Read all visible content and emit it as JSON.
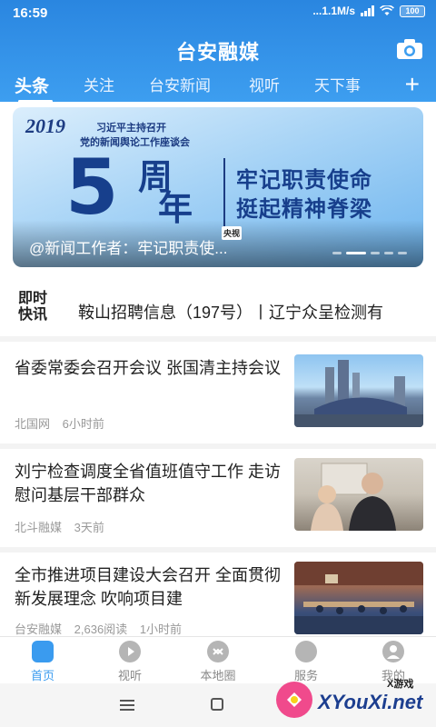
{
  "status_bar": {
    "time": "16:59",
    "speed": "...1.1M/s",
    "battery": "100"
  },
  "header": {
    "app_title": "台安融媒",
    "tabs": [
      {
        "label": "头条",
        "active": true
      },
      {
        "label": "关注"
      },
      {
        "label": "台安新闻"
      },
      {
        "label": "视听"
      },
      {
        "label": "天下事"
      }
    ],
    "add_tab": "+"
  },
  "banner": {
    "logo": "2019",
    "subtitle_1": "习近平主持召开",
    "subtitle_2": "党的新闻舆论工作座谈会",
    "big_number": "5",
    "big_word_1": "周",
    "big_word_2": "年",
    "slogan_1": "牢记职责使命",
    "slogan_2": "挺起精神脊梁",
    "badge": "央视",
    "caption": "@新闻工作者：牢记职责使..."
  },
  "flash": {
    "logo_line1": "即时",
    "logo_line2": "快讯",
    "text": "鞍山招聘信息（197号）丨辽宁众呈检测有"
  },
  "news": [
    {
      "title": "省委常委会召开会议 张国清主持会议",
      "source": "北国网",
      "time": "6小时前"
    },
    {
      "title": "刘宁检查调度全省值班值守工作 走访慰问基层干部群众",
      "source": "北斗融媒",
      "time": "3天前"
    },
    {
      "title": "全市推进项目建设大会召开 全面贯彻新发展理念 吹响项目建",
      "source": "台安融媒",
      "reads": "2,636阅读",
      "time": "1小时前"
    }
  ],
  "bottom_nav": [
    {
      "label": "首页",
      "active": true
    },
    {
      "label": "视听"
    },
    {
      "label": "本地圈"
    },
    {
      "label": "服务"
    },
    {
      "label": "我的"
    }
  ],
  "watermark": {
    "text": "XYouXi.net",
    "small": "X游戏"
  },
  "colors": {
    "accent": "#3a9bef",
    "header_top": "#2a86e0",
    "header_bottom": "#3d9ef0"
  }
}
